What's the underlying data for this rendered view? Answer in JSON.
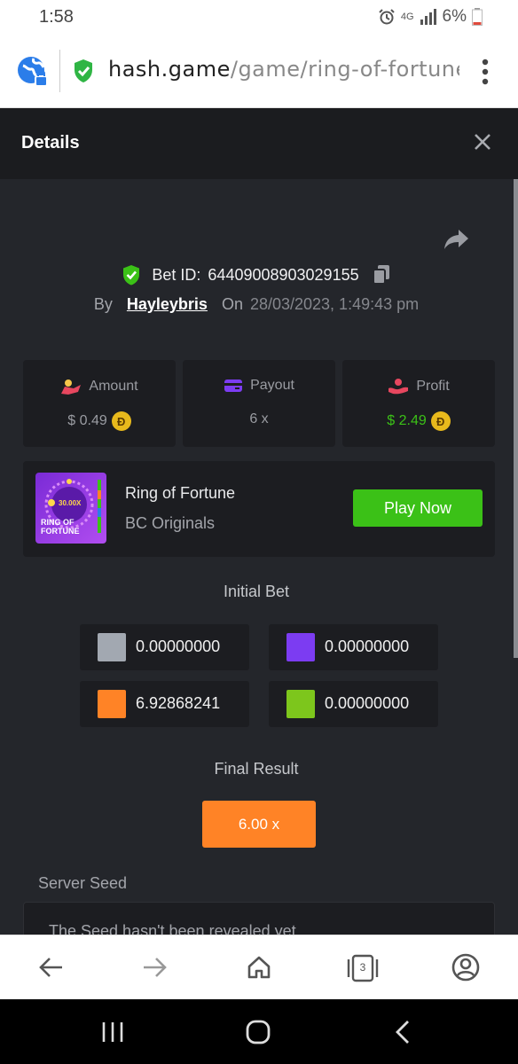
{
  "status_bar": {
    "time": "1:58",
    "network": "4G",
    "battery": "6%"
  },
  "browser": {
    "url_host": "hash.game",
    "url_path": "/game/ring-of-fortune",
    "tab_count": "3"
  },
  "details": {
    "title": "Details",
    "bet_id_label": "Bet ID:",
    "bet_id": "64409008903029155",
    "by_label": "By",
    "username": "Hayleybris",
    "on_label": "On",
    "datetime": "28/03/2023, 1:49:43 pm"
  },
  "stats": {
    "amount_label": "Amount",
    "amount_value": "$ 0.49",
    "payout_label": "Payout",
    "payout_value": "6 x",
    "profit_label": "Profit",
    "profit_value": "$ 2.49",
    "coin_symbol": "Đ"
  },
  "game": {
    "name": "Ring of Fortune",
    "provider": "BC Originals",
    "play_label": "Play Now",
    "thumb_multiplier": "30.00X",
    "thumb_title_1": "RING OF",
    "thumb_title_2": "FORTUNE"
  },
  "initial_bet": {
    "heading": "Initial Bet",
    "bets": [
      {
        "color": "#a2a8b1",
        "value": "0.00000000"
      },
      {
        "color": "#7c3cf2",
        "value": "0.00000000"
      },
      {
        "color": "#ff8326",
        "value": "6.92868241"
      },
      {
        "color": "#7dc61c",
        "value": "0.00000000"
      }
    ]
  },
  "final_result": {
    "heading": "Final Result",
    "value": "6.00 x"
  },
  "server_seed": {
    "label": "Server Seed",
    "text": "The Seed hasn't been revealed yet"
  },
  "colors": {
    "accent_green": "#3bc117",
    "result_orange": "#ff8326",
    "profit_green": "#3bc117",
    "page_bg": "#24262b"
  }
}
